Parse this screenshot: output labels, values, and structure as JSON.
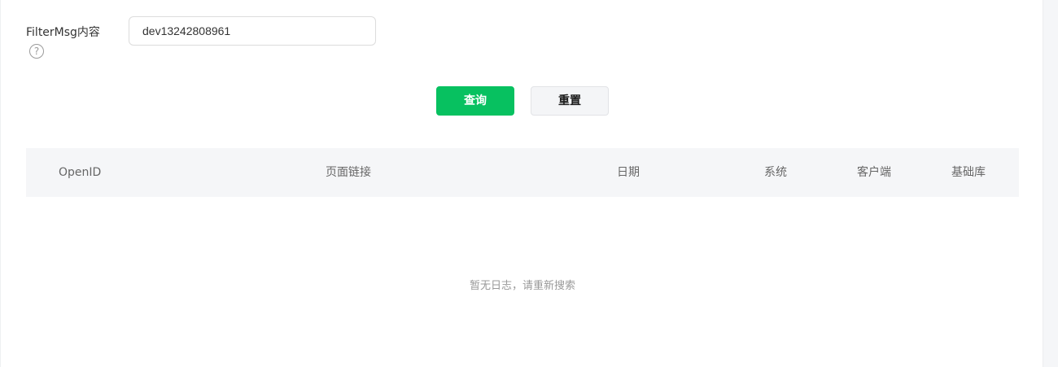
{
  "filter": {
    "label": "FilterMsg内容",
    "help_glyph": "?",
    "input_value": "dev13242808961"
  },
  "buttons": {
    "query_label": "查询",
    "reset_label": "重置"
  },
  "table": {
    "columns": [
      "OpenID",
      "页面链接",
      "日期",
      "系统",
      "客户端",
      "基础库"
    ],
    "empty_text": "暂无日志，请重新搜索"
  },
  "colors": {
    "primary": "#07c160",
    "header_bg": "#f5f6f8",
    "muted_text": "#999999"
  }
}
